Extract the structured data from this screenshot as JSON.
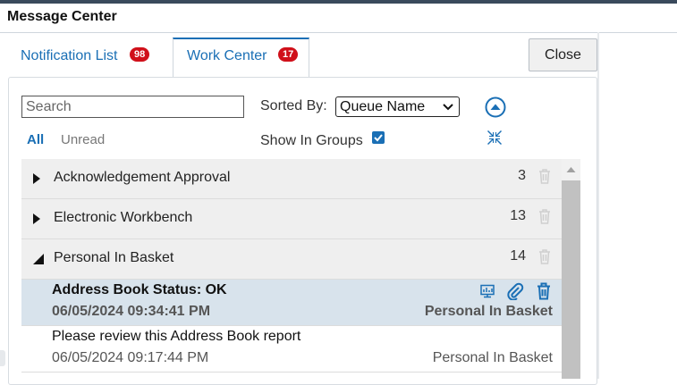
{
  "window": {
    "title": "Message Center"
  },
  "tabs": [
    {
      "label": "Notification List",
      "badge": "98"
    },
    {
      "label": "Work Center",
      "badge": "17"
    }
  ],
  "close_label": "Close",
  "toolbar": {
    "search_placeholder": "Search",
    "sorted_by_label": "Sorted By:",
    "sort_value": "Queue Name",
    "filter_all": "All",
    "filter_unread": "Unread",
    "show_groups_label": "Show In Groups",
    "show_groups_checked": true
  },
  "groups": [
    {
      "name": "Acknowledgement Approval",
      "count": "3",
      "expanded": false
    },
    {
      "name": "Electronic Workbench",
      "count": "13",
      "expanded": false
    },
    {
      "name": "Personal In Basket",
      "count": "14",
      "expanded": true
    }
  ],
  "items": [
    {
      "subject": "Address Book Status: OK",
      "date": "06/05/2024 09:34:41 PM",
      "queue": "Personal In Basket",
      "selected": true
    },
    {
      "subject": "Please review this Address Book report",
      "date": "06/05/2024 09:17:44 PM",
      "queue": "Personal In Basket",
      "selected": false
    }
  ],
  "colors": {
    "accent": "#1a6fb5",
    "badge": "#d0101a",
    "selected_row": "#d8e3ec",
    "group_row": "#efefef"
  },
  "icons": [
    "scroll-up-circle-icon",
    "collapse-arrows-icon",
    "expand-triangle-icon",
    "trash-icon",
    "monitor-icon",
    "paperclip-icon"
  ]
}
